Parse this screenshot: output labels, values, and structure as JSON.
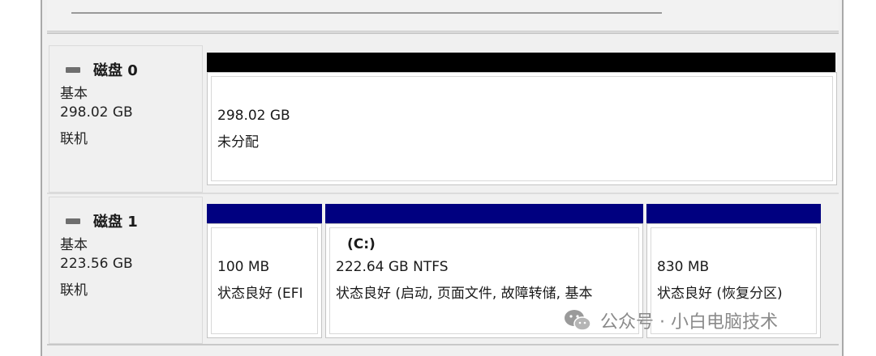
{
  "disks": [
    {
      "name": "磁盘 0",
      "type": "基本",
      "size": "298.02 GB",
      "status": "联机",
      "partitions": [
        {
          "line1": "298.02 GB",
          "line2": "未分配",
          "header_color": "#000000"
        }
      ]
    },
    {
      "name": "磁盘 1",
      "type": "基本",
      "size": "223.56 GB",
      "status": "联机",
      "partitions": [
        {
          "drive": "",
          "line1": "100 MB",
          "line2": "状态良好 (EFI",
          "header_color": "#000080"
        },
        {
          "drive": "(C:)",
          "line1": "222.64 GB NTFS",
          "line2": "状态良好 (启动, 页面文件, 故障转储, 基本",
          "header_color": "#000080"
        },
        {
          "drive": "",
          "line1": "830 MB",
          "line2": "状态良好 (恢复分区)",
          "header_color": "#000080"
        }
      ]
    }
  ],
  "watermark": {
    "text": "公众号 · 小白电脑技术",
    "icon": "wechat-icon"
  }
}
